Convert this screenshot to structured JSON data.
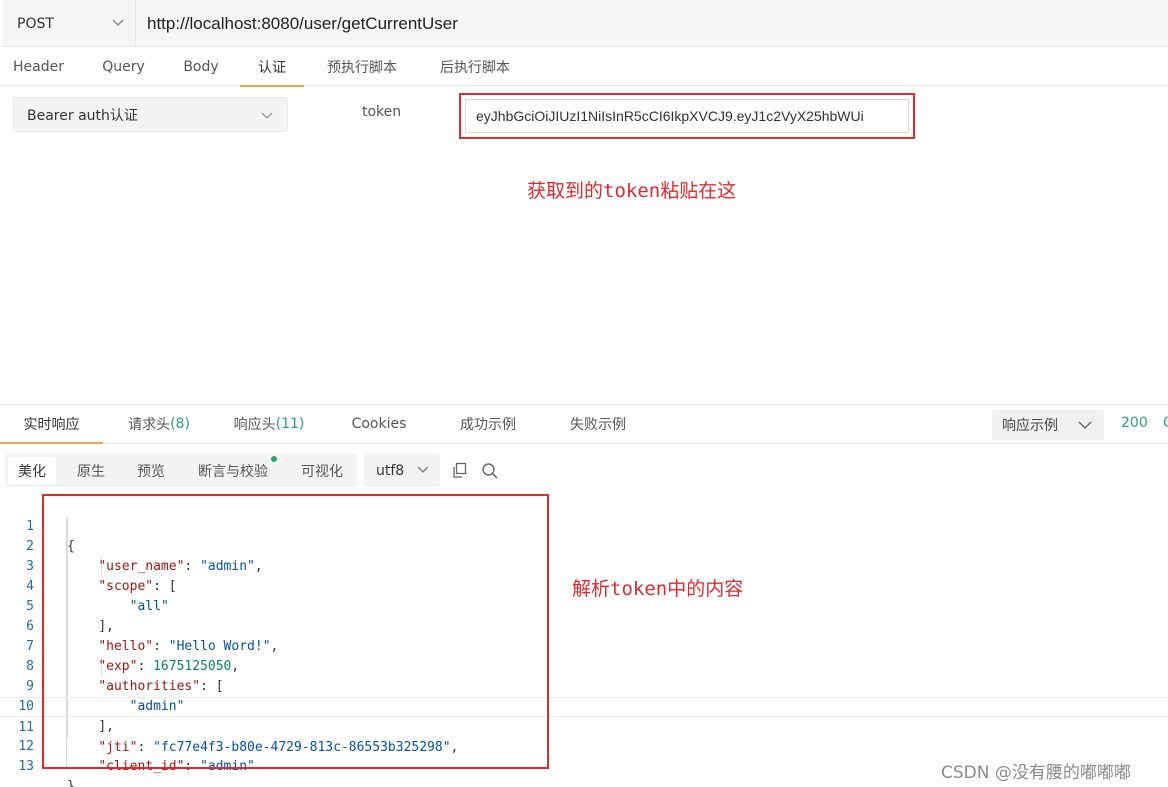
{
  "request": {
    "method": "POST",
    "url": "http://localhost:8080/user/getCurrentUser"
  },
  "request_tabs": [
    "Header",
    "Query",
    "Body",
    "认证",
    "预执行脚本",
    "后执行脚本"
  ],
  "auth": {
    "type_label": "Bearer auth认证",
    "token_label": "token",
    "token_value": "eyJhbGciOiJIUzI1NiIsInR5cCI6IkpXVCJ9.eyJ1c2VyX25hbWUi"
  },
  "annotations": {
    "token_note": "获取到的token粘贴在这",
    "content_note": "解析token中的内容"
  },
  "response_tabs": {
    "realtime": "实时响应",
    "req_headers": "请求头",
    "req_headers_count": "(8)",
    "resp_headers": "响应头",
    "resp_headers_count": "(11)",
    "cookies": "Cookies",
    "success_example": "成功示例",
    "fail_example": "失败示例"
  },
  "response_example_select": "响应示例",
  "status_code": "200",
  "status_extra": "O",
  "format_buttons": [
    "美化",
    "原生",
    "预览",
    "断言与校验",
    "可视化"
  ],
  "encoding": "utf8",
  "code_lines": [
    {
      "no": "1"
    },
    {
      "no": "2"
    },
    {
      "no": "3"
    },
    {
      "no": "4"
    },
    {
      "no": "5"
    },
    {
      "no": "6"
    },
    {
      "no": "7"
    },
    {
      "no": "8"
    },
    {
      "no": "9"
    },
    {
      "no": "10"
    },
    {
      "no": "11"
    },
    {
      "no": "12"
    },
    {
      "no": "13"
    }
  ],
  "json_content": {
    "user_name": "admin",
    "scope_item": "all",
    "hello": "Hello Word!",
    "exp": "1675125050",
    "authority_item": "admin",
    "jti": "fc77e4f3-b80e-4729-813c-86553b325298",
    "client_id": "admin"
  },
  "watermark": "CSDN @没有腰的嘟嘟嘟"
}
